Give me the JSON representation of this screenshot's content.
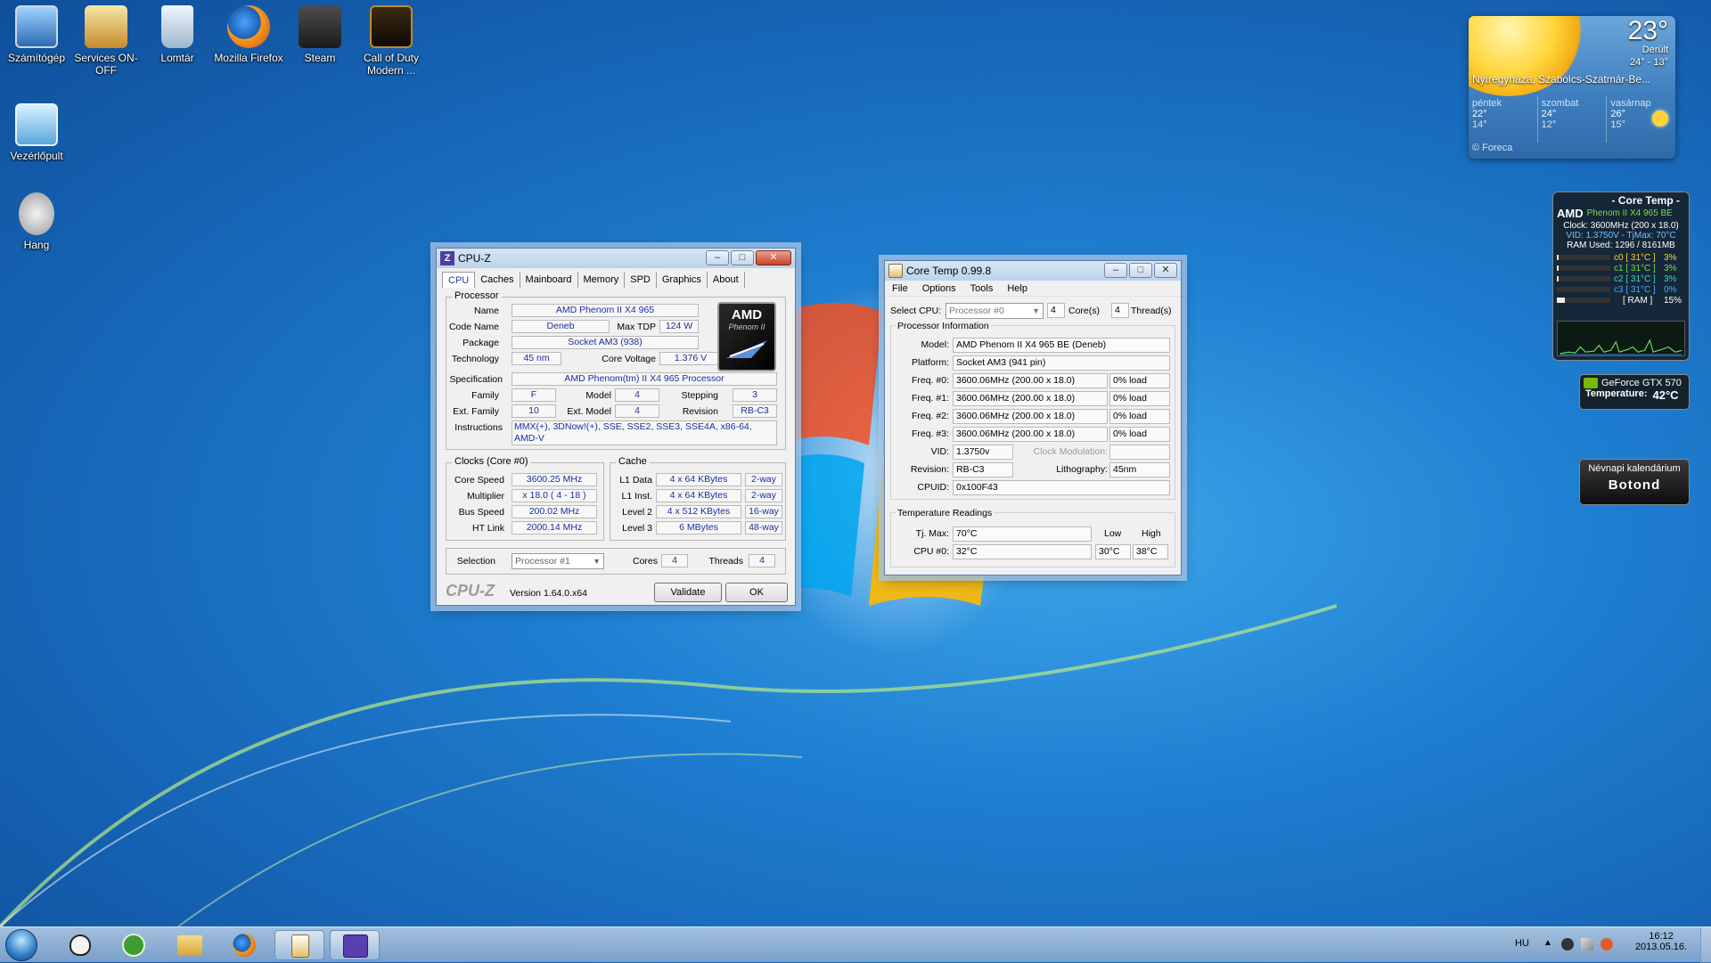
{
  "desktop": {
    "icons": [
      {
        "label": "Számítógép",
        "icon": "computer-icon"
      },
      {
        "label": "Services ON-OFF",
        "icon": "services-icon"
      },
      {
        "label": "Lomtár",
        "icon": "recycle-bin-icon"
      },
      {
        "label": "Mozilla Firefox",
        "icon": "firefox-icon"
      },
      {
        "label": "Steam",
        "icon": "steam-icon"
      },
      {
        "label": "Call of Duty Modern ...",
        "icon": "cod-icon"
      },
      {
        "label": "Vezérlőpult",
        "icon": "control-panel-icon"
      },
      {
        "label": "Hang",
        "icon": "speaker-icon"
      }
    ]
  },
  "cpuz": {
    "title": "CPU-Z",
    "tabs": [
      "CPU",
      "Caches",
      "Mainboard",
      "Memory",
      "SPD",
      "Graphics",
      "About"
    ],
    "active_tab": "CPU",
    "processor": {
      "group": "Processor",
      "name_label": "Name",
      "name": "AMD Phenom II X4 965",
      "codename_label": "Code Name",
      "codename": "Deneb",
      "maxtdp_label": "Max TDP",
      "maxtdp": "124 W",
      "package_label": "Package",
      "package": "Socket AM3 (938)",
      "technology_label": "Technology",
      "technology": "45 nm",
      "corevoltage_label": "Core Voltage",
      "corevoltage": "1.376 V",
      "spec_label": "Specification",
      "spec": "AMD Phenom(tm) II X4 965 Processor",
      "family_label": "Family",
      "family": "F",
      "model_label": "Model",
      "model": "4",
      "stepping_label": "Stepping",
      "stepping": "3",
      "extfamily_label": "Ext. Family",
      "extfamily": "10",
      "extmodel_label": "Ext. Model",
      "extmodel": "4",
      "revision_label": "Revision",
      "revision": "RB-C3",
      "instructions_label": "Instructions",
      "instructions": "MMX(+), 3DNow!(+), SSE, SSE2, SSE3, SSE4A, x86-64, AMD-V",
      "logo_brand": "AMD",
      "logo_sub": "Phenom II"
    },
    "clocks": {
      "group": "Clocks (Core #0)",
      "corespeed_label": "Core Speed",
      "corespeed": "3600.25 MHz",
      "multiplier_label": "Multiplier",
      "multiplier": "x 18.0 ( 4 - 18 )",
      "busspeed_label": "Bus Speed",
      "busspeed": "200.02 MHz",
      "htlink_label": "HT Link",
      "htlink": "2000.14 MHz"
    },
    "cache": {
      "group": "Cache",
      "l1d_label": "L1 Data",
      "l1d": "4 x 64 KBytes",
      "l1d_way": "2-way",
      "l1i_label": "L1 Inst.",
      "l1i": "4 x 64 KBytes",
      "l1i_way": "2-way",
      "l2_label": "Level 2",
      "l2": "4 x 512 KBytes",
      "l2_way": "16-way",
      "l3_label": "Level 3",
      "l3": "6 MBytes",
      "l3_way": "48-way"
    },
    "selection_label": "Selection",
    "selection": "Processor #1",
    "cores_label": "Cores",
    "cores": "4",
    "threads_label": "Threads",
    "threads": "4",
    "brand": "CPU-Z",
    "version": "Version 1.64.0.x64",
    "validate": "Validate",
    "ok": "OK"
  },
  "coretemp": {
    "title": "Core Temp 0.99.8",
    "menu": [
      "File",
      "Options",
      "Tools",
      "Help"
    ],
    "selectcpu_label": "Select CPU:",
    "selectcpu": "Processor #0",
    "cores_num": "4",
    "cores_label": "Core(s)",
    "threads_num": "4",
    "threads_label": "Thread(s)",
    "procinfo_label": "Processor Information",
    "model_label": "Model:",
    "model": "AMD Phenom II X4 965 BE (Deneb)",
    "platform_label": "Platform:",
    "platform": "Socket AM3 (941 pin)",
    "freqs": [
      {
        "label": "Freq. #0:",
        "value": "3600.06MHz (200.00 x 18.0)",
        "load": "0% load"
      },
      {
        "label": "Freq. #1:",
        "value": "3600.06MHz (200.00 x 18.0)",
        "load": "0% load"
      },
      {
        "label": "Freq. #2:",
        "value": "3600.06MHz (200.00 x 18.0)",
        "load": "0% load"
      },
      {
        "label": "Freq. #3:",
        "value": "3600.06MHz (200.00 x 18.0)",
        "load": "0% load"
      }
    ],
    "vid_label": "VID:",
    "vid": "1.3750v",
    "clockmod_label": "Clock Modulation:",
    "revision_label": "Revision:",
    "revision": "RB-C3",
    "litho_label": "Lithography:",
    "litho": "45nm",
    "cpuid_label": "CPUID:",
    "cpuid": "0x100F43",
    "tempreadings_label": "Temperature Readings",
    "tjmax_label": "Tj. Max:",
    "tjmax": "70°C",
    "low_label": "Low",
    "high_label": "High",
    "cpu0_label": "CPU #0:",
    "cpu0": "32°C",
    "cpu0_low": "30°C",
    "cpu0_high": "38°C"
  },
  "weather_gadget": {
    "temp": "23°",
    "condition": "Derült",
    "range": "24° - 13°",
    "location": "Nyíregyháza, Szabolcs-Szatmár-Be...",
    "days": [
      {
        "name": "péntek",
        "high": "22°",
        "low": "14°"
      },
      {
        "name": "szombat",
        "high": "24°",
        "low": "12°"
      },
      {
        "name": "vasárnap",
        "high": "26°",
        "low": "15°"
      }
    ],
    "source": "© Foreca"
  },
  "coretemp_gadget": {
    "title": "- Core Temp -",
    "brand": "AMD",
    "cpu": "Phenom II X4 965 BE",
    "clock": "Clock: 3600MHz (200 x 18.0)",
    "vid": "VID: 1.3750V - TjMax: 70°C",
    "ram": "RAM Used: 1296 / 8161MB",
    "cores": [
      {
        "label": "c0 [ 31°C ]",
        "load": "3%",
        "fraction": 0.03
      },
      {
        "label": "c1 [ 31°C ]",
        "load": "3%",
        "fraction": 0.03
      },
      {
        "label": "c2 [ 31°C ]",
        "load": "3%",
        "fraction": 0.03
      },
      {
        "label": "c3 [ 31°C ]",
        "load": "0%",
        "fraction": 0.0
      }
    ],
    "ram_label": "[ RAM ]",
    "ram_load": "15%",
    "ram_fraction": 0.15
  },
  "gpu_gadget": {
    "name": "GeForce GTX 570",
    "temp_label": "Temperature:",
    "temp": "42°C"
  },
  "nameday_gadget": {
    "title": "Névnapi kalendárium",
    "name": "Botond"
  },
  "taskbar": {
    "items": [
      "start-orb-icon",
      "alienware-icon",
      "utorrent-icon",
      "explorer-icon",
      "firefox-icon",
      "coretemp-icon",
      "cpuz-icon"
    ],
    "lang": "HU",
    "time": "16:12",
    "date": "2013.05.16."
  },
  "colors": {
    "cpuz_value": "#1c2e9c",
    "accent_win": "#5a7ea8"
  }
}
